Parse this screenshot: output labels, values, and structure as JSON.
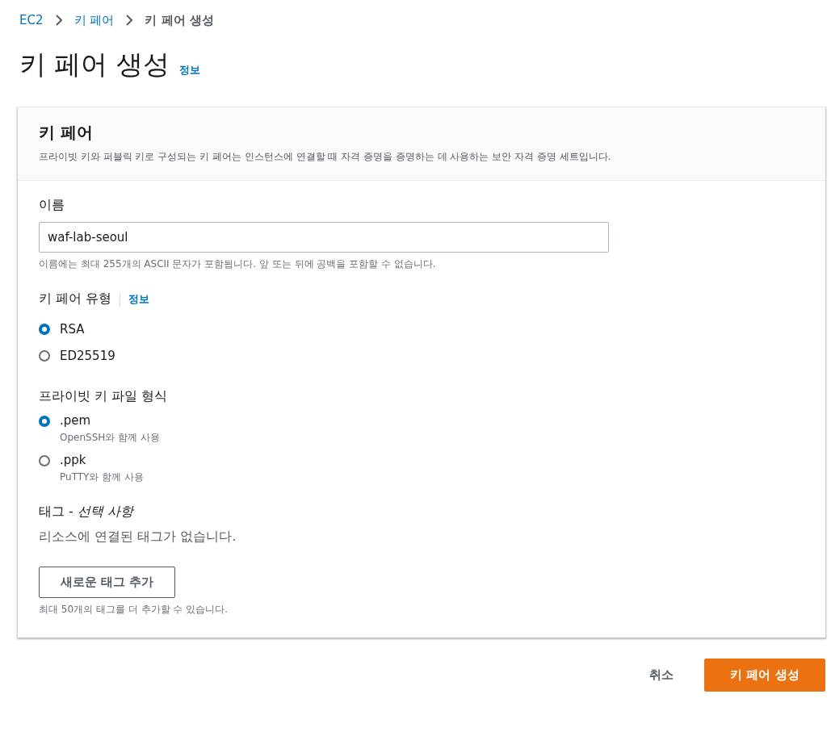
{
  "breadcrumb": [
    {
      "label": "EC2",
      "link": true
    },
    {
      "label": "키 페어",
      "link": true
    },
    {
      "label": "키 페어 생성",
      "link": false
    }
  ],
  "page": {
    "title": "키 페어 생성",
    "info": "정보"
  },
  "card": {
    "title": "키 페어",
    "description": "프라이빗 키와 퍼블릭 키로 구성되는 키 페어는 인스턴스에 연결할 때 자격 증명을 증명하는 데 사용하는 보안 자격 증명 세트입니다."
  },
  "name_field": {
    "label": "이름",
    "value": "waf-lab-seoul",
    "hint": "이름에는 최대 255개의 ASCII 문자가 포함됩니다. 앞 또는 뒤에 공백을 포함할 수 없습니다."
  },
  "key_type": {
    "label": "키 페어 유형",
    "info": "정보",
    "options": [
      {
        "label": "RSA",
        "selected": true
      },
      {
        "label": "ED25519",
        "selected": false
      }
    ]
  },
  "file_format": {
    "label": "프라이빗 키 파일 형식",
    "options": [
      {
        "label": ".pem",
        "description": "OpenSSH와 함께 사용",
        "selected": true
      },
      {
        "label": ".ppk",
        "description": "PuTTY와 함께 사용",
        "selected": false
      }
    ]
  },
  "tags": {
    "label": "태그 - *선택 사항*",
    "empty_text": "리소스에 연결된 태그가 없습니다.",
    "add_button": "새로운 태그 추가",
    "hint": "최대 50개의 태그를 더 추가할 수 있습니다."
  },
  "actions": {
    "cancel": "취소",
    "submit": "키 페어 생성"
  }
}
